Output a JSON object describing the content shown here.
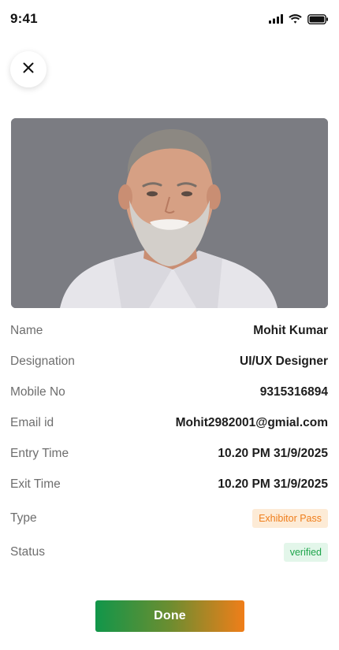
{
  "status_bar": {
    "time": "9:41"
  },
  "icons": {
    "close": "close-icon",
    "signal": "signal-icon",
    "wifi": "wifi-icon",
    "battery": "battery-icon",
    "photo": "profile-photo"
  },
  "fields": {
    "name": {
      "label": "Name",
      "value": "Mohit Kumar"
    },
    "designation": {
      "label": "Designation",
      "value": "UI/UX Designer"
    },
    "mobile": {
      "label": "Mobile No",
      "value": "9315316894"
    },
    "email": {
      "label": "Email id",
      "value": "Mohit2982001@gmial.com"
    },
    "entry_time": {
      "label": "Entry Time",
      "value": "10.20 PM 31/9/2025"
    },
    "exit_time": {
      "label": "Exit Time",
      "value": "10.20 PM 31/9/2025"
    },
    "type": {
      "label": "Type",
      "value": "Exhibitor Pass"
    },
    "status": {
      "label": "Status",
      "value": "verified"
    }
  },
  "actions": {
    "done_label": "Done"
  },
  "colors": {
    "type_badge_bg": "#fdebd6",
    "type_badge_text": "#ef7d1a",
    "status_badge_bg": "#e3f6ea",
    "status_badge_text": "#1fa54c",
    "done_gradient_start": "#11964a",
    "done_gradient_end": "#f07e19",
    "photo_background": "#7b7c82"
  }
}
